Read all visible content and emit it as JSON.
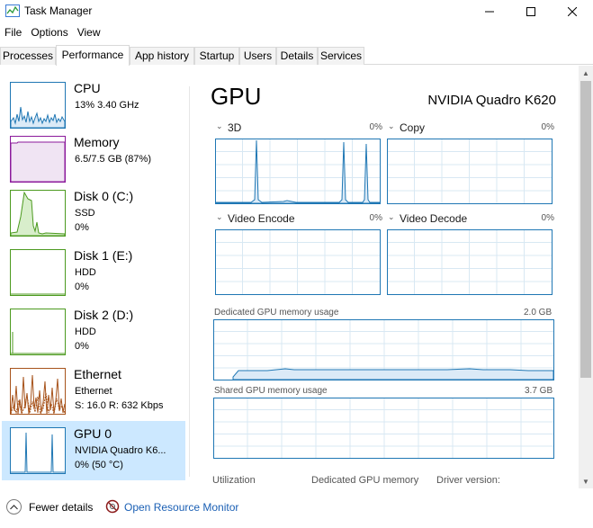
{
  "window": {
    "title": "Task Manager"
  },
  "menu": [
    "File",
    "Options",
    "View"
  ],
  "tabs": [
    "Processes",
    "Performance",
    "App history",
    "Startup",
    "Users",
    "Details",
    "Services"
  ],
  "active_tab": "Performance",
  "sidebar": {
    "items": [
      {
        "title": "CPU",
        "line1": "13%  3.40 GHz",
        "line2": "",
        "color": "#1f77b4"
      },
      {
        "title": "Memory",
        "line1": "6.5/7.5 GB (87%)",
        "line2": "",
        "color": "#8b1a9b"
      },
      {
        "title": "Disk 0 (C:)",
        "line1": "SSD",
        "line2": "0%",
        "color": "#4c9a1f"
      },
      {
        "title": "Disk 1 (E:)",
        "line1": "HDD",
        "line2": "0%",
        "color": "#4c9a1f"
      },
      {
        "title": "Disk 2 (D:)",
        "line1": "HDD",
        "line2": "0%",
        "color": "#4c9a1f"
      },
      {
        "title": "Ethernet",
        "line1": "Ethernet",
        "line2": "S: 16.0  R: 632 Kbps",
        "color": "#a7531b"
      },
      {
        "title": "GPU 0",
        "line1": "NVIDIA Quadro K6...",
        "line2": "0% (50 °C)",
        "color": "#1f77b4"
      }
    ]
  },
  "main": {
    "title": "GPU",
    "model": "NVIDIA Quadro K620",
    "engines": [
      {
        "label": "3D",
        "pct": "0%"
      },
      {
        "label": "Copy",
        "pct": "0%"
      },
      {
        "label": "Video Encode",
        "pct": "0%"
      },
      {
        "label": "Video Decode",
        "pct": "0%"
      }
    ],
    "dedicated": {
      "label": "Dedicated GPU memory usage",
      "max": "2.0 GB"
    },
    "shared": {
      "label": "Shared GPU memory usage",
      "max": "3.7 GB"
    },
    "stats": {
      "utilization": "Utilization",
      "dedicated_memory": "Dedicated GPU memory",
      "driver_version": "Driver version:"
    }
  },
  "footer": {
    "fewer_details": "Fewer details",
    "open_monitor": "Open Resource Monitor"
  },
  "colors": {
    "gpu_line": "#1f77b4",
    "grid": "#d8e8f3",
    "selected": "#cce8ff",
    "link": "#1a5fb4"
  }
}
